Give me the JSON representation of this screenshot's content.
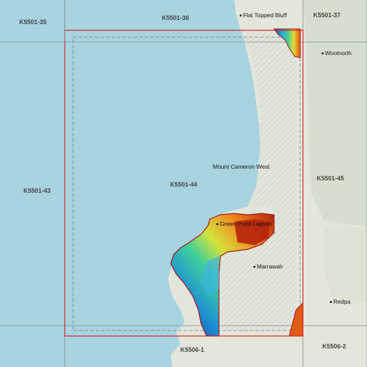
{
  "map": {
    "grid_labels": {
      "k35": "K5501-35",
      "k36": "K5501-36",
      "k37": "K5501-37",
      "k43": "K5501-43",
      "k44": "K5501-44",
      "k45": "K5501-45",
      "k1": "K5506-1",
      "k2": "K5506-2"
    },
    "places": {
      "flat_topped_bluff": "Flat Topped Bluff",
      "woolnorth": "Woolnorth",
      "mount_cameron_west": "Mount Cameron West",
      "green_point_lagoon": "Green Point Lagoon",
      "marrawah": "Marrawah",
      "redpa": "Redpa"
    },
    "colors": {
      "sea": "#a8d3e0",
      "land": "#e4e6dc",
      "highlight_border": "#d32222",
      "grid_line": "#7a8790",
      "dem_low": "#1b2a8a",
      "dem_high": "#b3200a"
    },
    "highlighted_tile": "K5501-44",
    "layer": "elevation-colored DEM"
  }
}
